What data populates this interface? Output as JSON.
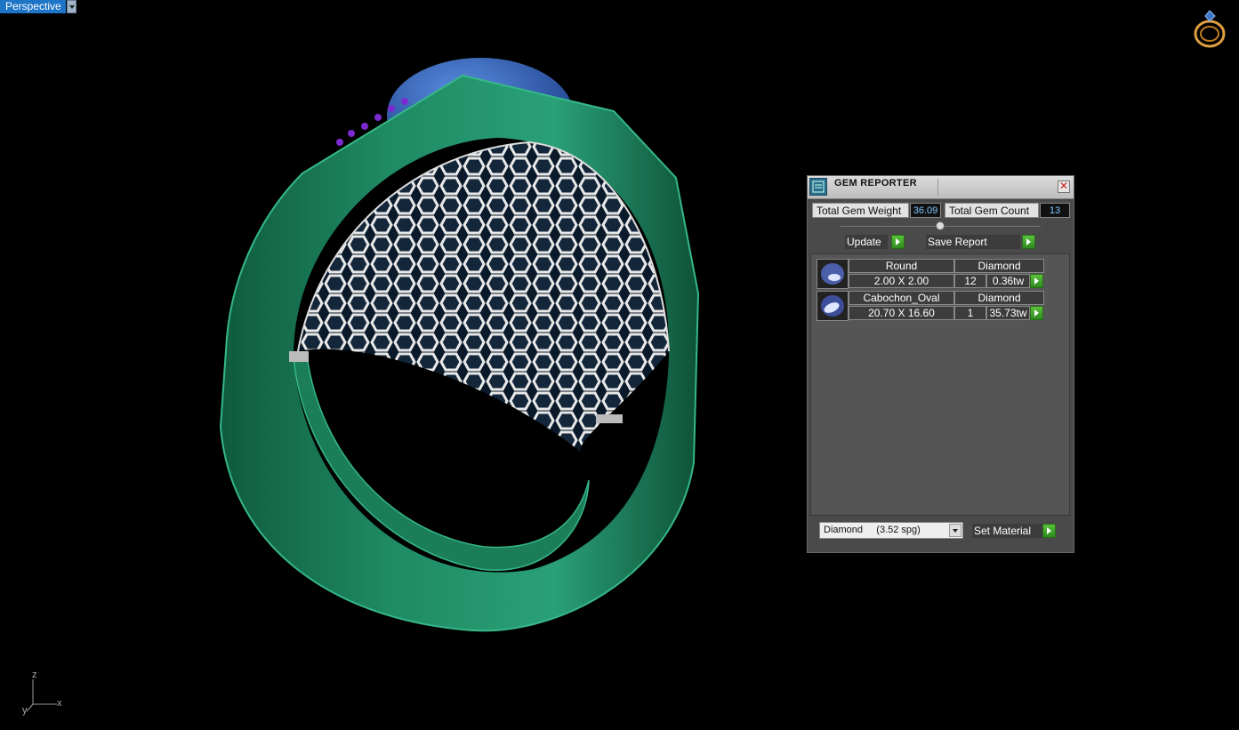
{
  "viewport": {
    "label": "Perspective",
    "axes": {
      "x": "x",
      "y": "y",
      "z": "z"
    }
  },
  "icons": {
    "viewport_menu": "chevron-down-icon",
    "ring_logo": "ring-icon",
    "gem_reporter": "gem-report-icon",
    "close": "close-icon"
  },
  "panel": {
    "title": "GEM REPORTER",
    "close_glyph": "✕",
    "total_weight_label": "Total Gem Weight",
    "total_weight_value": "36.09",
    "total_count_label": "Total Gem Count",
    "total_count_value": "13",
    "update_label": "Update",
    "save_report_label": "Save Report",
    "gems": [
      {
        "shape": "Round",
        "material": "Diamond",
        "size": "2.00 X 2.00",
        "count": "12",
        "weight": "0.36tw"
      },
      {
        "shape": "Cabochon_Oval",
        "material": "Diamond",
        "size": "20.70 X 16.60",
        "count": "1",
        "weight": "35.73tw"
      }
    ],
    "material_select": "Diamond     (3.52 spg)",
    "set_material_label": "Set Material"
  },
  "colors": {
    "ring_green": "#1f8a63",
    "gem_blue": "#2f5fb8",
    "viewport_label_bg": "#1e74c6",
    "button_green": "#3fa82a"
  }
}
